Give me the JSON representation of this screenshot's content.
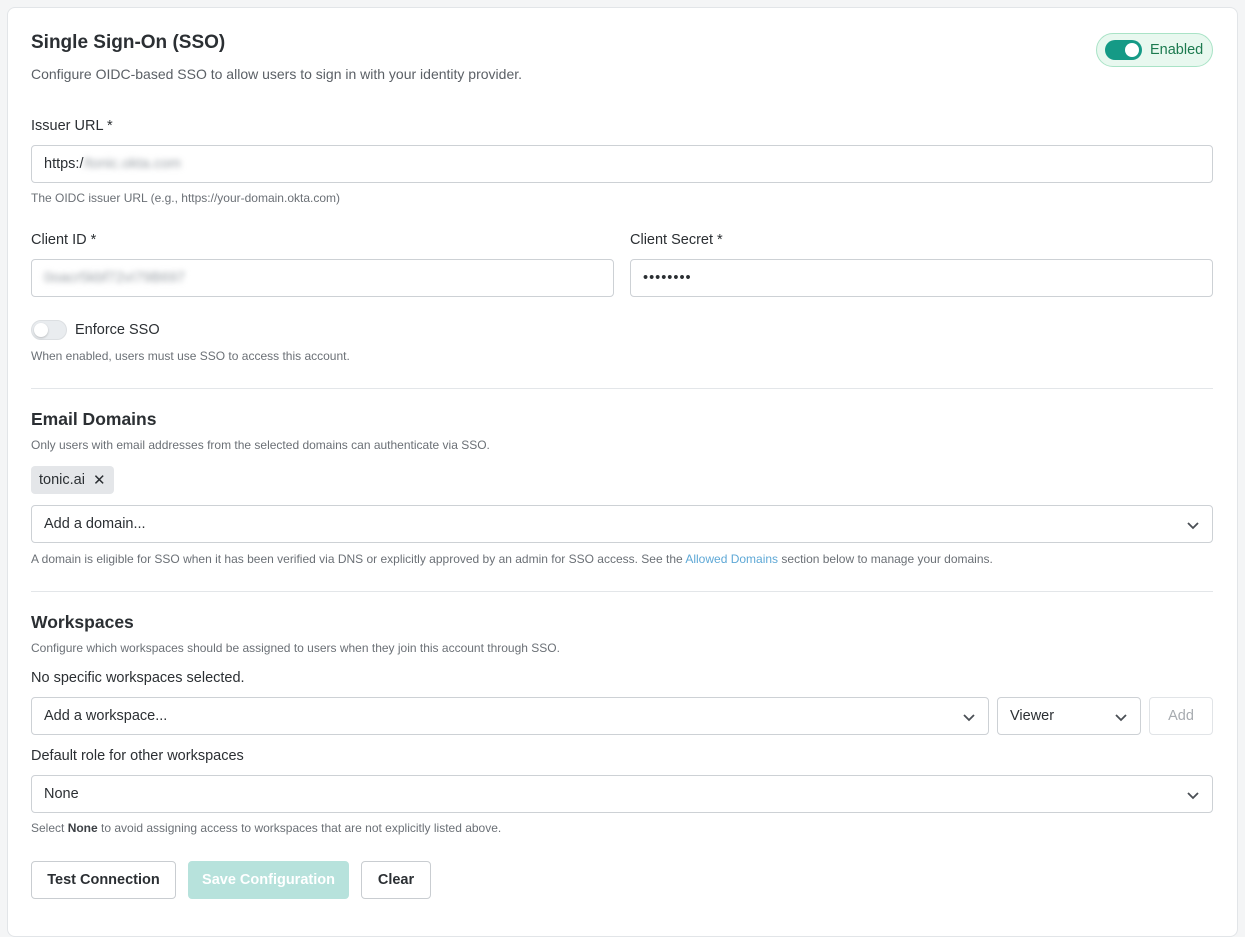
{
  "header": {
    "title": "Single Sign-On (SSO)",
    "subtitle": "Configure OIDC-based SSO to allow users to sign in with your identity provider.",
    "toggle_label": "Enabled",
    "enabled": true
  },
  "issuer": {
    "label": "Issuer URL *",
    "value_prefix": "https:/",
    "value_blurred": "/tonic.okta.com",
    "help": "The OIDC issuer URL (e.g., https://your-domain.okta.com)"
  },
  "client_id": {
    "label": "Client ID *",
    "value_blurred": "0oacr5kbf72vI79B697"
  },
  "client_secret": {
    "label": "Client Secret *",
    "value": "••••••••"
  },
  "enforce": {
    "label": "Enforce SSO",
    "help": "When enabled, users must use SSO to access this account.",
    "enabled": false
  },
  "email_domains": {
    "title": "Email Domains",
    "subtitle": "Only users with email addresses from the selected domains can authenticate via SSO.",
    "chips": [
      "tonic.ai"
    ],
    "select_placeholder": "Add a domain...",
    "help_before": "A domain is eligible for SSO when it has been verified via DNS or explicitly approved by an admin for SSO access. See the ",
    "help_link": "Allowed Domains",
    "help_after": " section below to manage your domains."
  },
  "workspaces": {
    "title": "Workspaces",
    "subtitle": "Configure which workspaces should be assigned to users when they join this account through SSO.",
    "empty_text": "No specific workspaces selected.",
    "select_placeholder": "Add a workspace...",
    "role_value": "Viewer",
    "add_label": "Add",
    "default_role_label": "Default role for other workspaces",
    "default_role_value": "None",
    "help_before": "Select ",
    "help_bold": "None",
    "help_after": " to avoid assigning access to workspaces that are not explicitly listed above."
  },
  "actions": {
    "test_label": "Test Connection",
    "save_label": "Save Configuration",
    "clear_label": "Clear"
  },
  "colors": {
    "accent": "#159a86",
    "link": "#5ea8d6",
    "disabled_button": "#b7e2dc"
  }
}
